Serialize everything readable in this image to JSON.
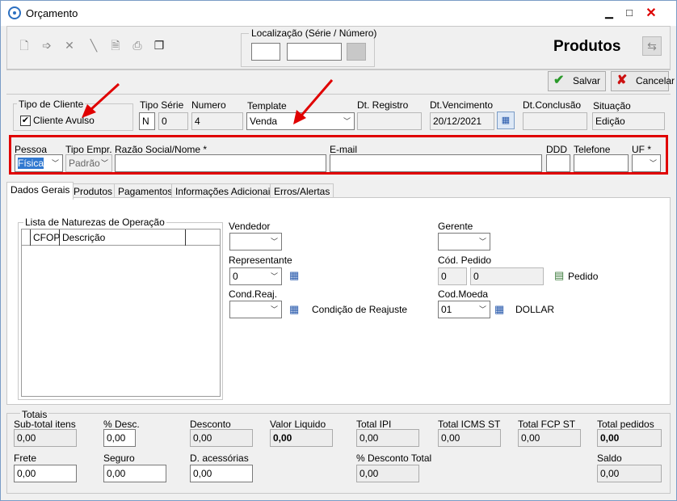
{
  "window": {
    "title": "Orçamento",
    "minimize": "▁",
    "maximize": "□",
    "close": "✕"
  },
  "toolbar": {
    "icons": [
      "new-icon",
      "edit-icon",
      "delete-icon",
      "pen-icon",
      "preview-icon",
      "print-icon",
      "copy-icon"
    ],
    "location": {
      "title": "Localização (Série / Número)",
      "serie": "",
      "numero": ""
    },
    "section_title": "Produtos",
    "save_label": "Salvar",
    "cancel_label": "Cancelar"
  },
  "header": {
    "tipo_cliente": {
      "title": "Tipo de Cliente",
      "checkbox_label": "Cliente Avulso",
      "checked": true
    },
    "tipo_serie": {
      "label": "Tipo Série",
      "value": "N",
      "value2": "0"
    },
    "numero": {
      "label": "Numero",
      "value": "4"
    },
    "template": {
      "label": "Template",
      "value": "Venda"
    },
    "dt_registro": {
      "label": "Dt. Registro",
      "value": ""
    },
    "dt_vencimento": {
      "label": "Dt.Vencimento",
      "value": "20/12/2021"
    },
    "dt_conclusao": {
      "label": "Dt.Conclusão",
      "value": ""
    },
    "situacao": {
      "label": "Situação",
      "value": "Edição"
    }
  },
  "customer": {
    "pessoa": {
      "label": "Pessoa",
      "value": "Física"
    },
    "tipo_empr": {
      "label": "Tipo Empr.",
      "value": "Padrão"
    },
    "razao_social": {
      "label": "Razão Social/Nome *",
      "value": ""
    },
    "email": {
      "label": "E-mail",
      "value": ""
    },
    "ddd": {
      "label": "DDD",
      "value": ""
    },
    "telefone": {
      "label": "Telefone",
      "value": ""
    },
    "uf": {
      "label": "UF *",
      "value": ""
    }
  },
  "tabs": [
    "Dados Gerais",
    "Produtos",
    "Pagamentos",
    "Informações Adicionais",
    "Erros/Alertas"
  ],
  "dados_gerais": {
    "naturezas": {
      "title": "Lista de Naturezas de Operação",
      "columns": [
        "CFOP",
        "Descrição"
      ]
    },
    "vendedor": {
      "label": "Vendedor",
      "value": ""
    },
    "representante": {
      "label": "Representante",
      "value": "0"
    },
    "cond_reaj": {
      "label": "Cond.Reaj.",
      "value": "",
      "description": "Condição de Reajuste"
    },
    "gerente": {
      "label": "Gerente",
      "value": ""
    },
    "cod_pedido": {
      "label": "Cód. Pedido",
      "value1": "0",
      "value2": "0",
      "link": "Pedido"
    },
    "cod_moeda": {
      "label": "Cod.Moeda",
      "value": "01",
      "description": "DOLLAR"
    }
  },
  "totais": {
    "title": "Totais",
    "subtotal": {
      "label": "Sub-total itens",
      "value": "0,00"
    },
    "perc_desc": {
      "label": "% Desc.",
      "value": "0,00"
    },
    "desconto": {
      "label": "Desconto",
      "value": "0,00"
    },
    "valor_liquido": {
      "label": "Valor Liquido",
      "value": "0,00"
    },
    "total_ipi": {
      "label": "Total IPI",
      "value": "0,00"
    },
    "total_icms_st": {
      "label": "Total ICMS ST",
      "value": "0,00"
    },
    "total_fcp_st": {
      "label": "Total FCP ST",
      "value": "0,00"
    },
    "total_pedidos": {
      "label": "Total pedidos",
      "value": "0,00"
    },
    "frete": {
      "label": "Frete",
      "value": "0,00"
    },
    "seguro": {
      "label": "Seguro",
      "value": "0,00"
    },
    "d_acessorias": {
      "label": "D. acessórias",
      "value": "0,00"
    },
    "perc_desconto_total": {
      "label": "% Desconto Total",
      "value": "0,00"
    },
    "saldo": {
      "label": "Saldo",
      "value": "0,00"
    }
  }
}
